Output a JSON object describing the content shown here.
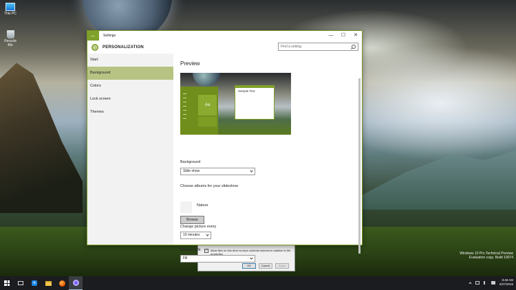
{
  "desktop": {
    "icons": [
      {
        "label": "This PC",
        "icon": "this-pc-icon"
      },
      {
        "label": "Recycle Bin",
        "icon": "recycle-bin-icon"
      }
    ],
    "watermark": {
      "line1": "Windows 10 Pro Technical Preview",
      "line2": "Evaluation copy. Build 10074"
    }
  },
  "dialog": {
    "checkbox_label": "Allow files on this drive to have contents indexed in addition to file properties",
    "checked": true,
    "ok_label": "OK",
    "cancel_label": "Cancel",
    "apply_label": "Apply"
  },
  "settings": {
    "title": "Settings",
    "back_glyph": "←",
    "controls": {
      "minimize": "—",
      "maximize": "☐",
      "close": "✕"
    },
    "header_title": "PERSONALIZATION",
    "search_placeholder": "Find a setting",
    "nav": [
      {
        "label": "Start",
        "active": false
      },
      {
        "label": "Background",
        "active": true
      },
      {
        "label": "Colors",
        "active": false
      },
      {
        "label": "Lock screen",
        "active": false
      },
      {
        "label": "Themes",
        "active": false
      }
    ],
    "preview_heading": "Preview",
    "preview_tile_text": "Aa",
    "preview_window_text": "Sample Text",
    "background_label": "Background",
    "background_value": "Slide show",
    "albums_label": "Choose albums for your slideshow",
    "album_name": "Nature",
    "browse_label": "Browse",
    "change_every_label": "Change picture every",
    "change_every_value": "10 minutes",
    "fit_label": "Choose a fit",
    "fit_value": "Fill",
    "accent_color": "#80a12a"
  },
  "taskbar": {
    "apps": [
      "windows-start-icon",
      "task-view-icon",
      "edge-icon",
      "file-explorer-icon",
      "firefox-icon",
      "settings-app-icon"
    ],
    "time": "8:49 AM",
    "date": "5/27/2015"
  }
}
